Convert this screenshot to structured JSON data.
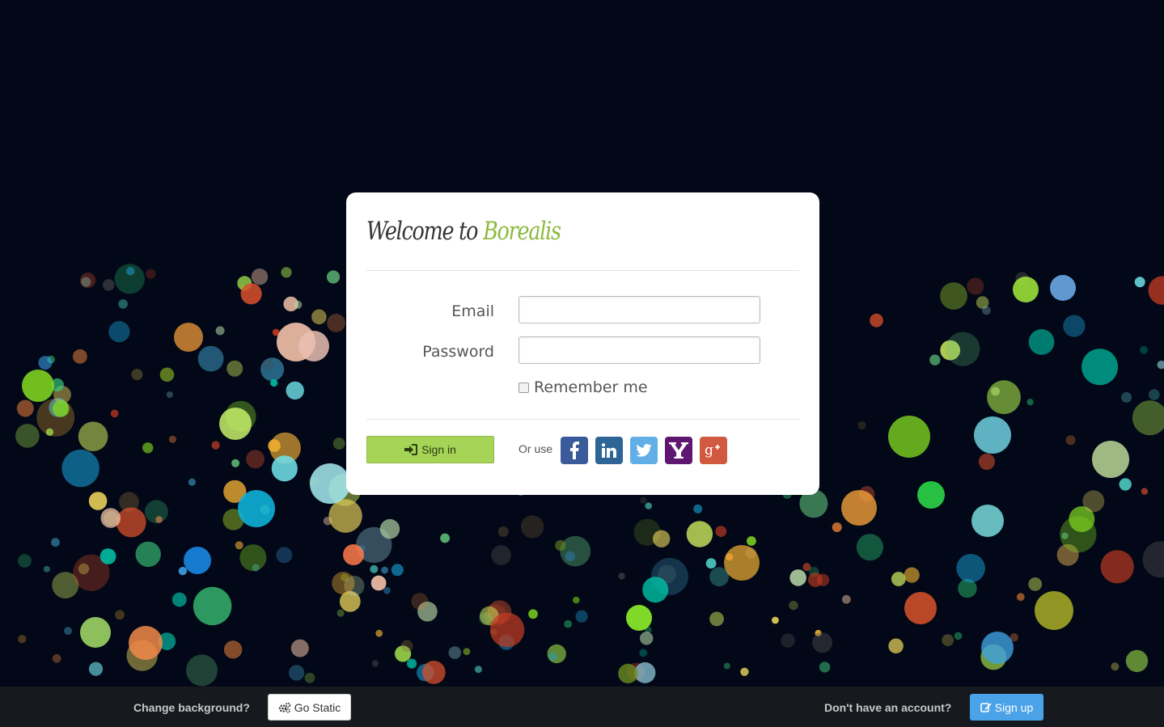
{
  "background": {
    "color": "#020817"
  },
  "card": {
    "title_prefix": "Welcome to ",
    "title_brand": "Borealis",
    "brand_color": "#8cba3e",
    "email_label": "Email",
    "email_value": "",
    "password_label": "Password",
    "password_value": "",
    "remember_label": "Remember me",
    "remember_checked": false,
    "signin_label": "Sign in",
    "or_use_label": "Or use",
    "social": [
      {
        "name": "facebook-icon",
        "color": "#3a5a99"
      },
      {
        "name": "linkedin-icon",
        "color": "#2f6496"
      },
      {
        "name": "twitter-icon",
        "color": "#62aee6"
      },
      {
        "name": "yahoo-icon",
        "color": "#5e1670"
      },
      {
        "name": "google-plus-icon",
        "color": "#d1593f"
      }
    ]
  },
  "footer": {
    "change_bg_text": "Change background?",
    "go_static_label": "Go Static",
    "no_account_text": "Don't have an account?",
    "signup_label": "Sign up"
  }
}
